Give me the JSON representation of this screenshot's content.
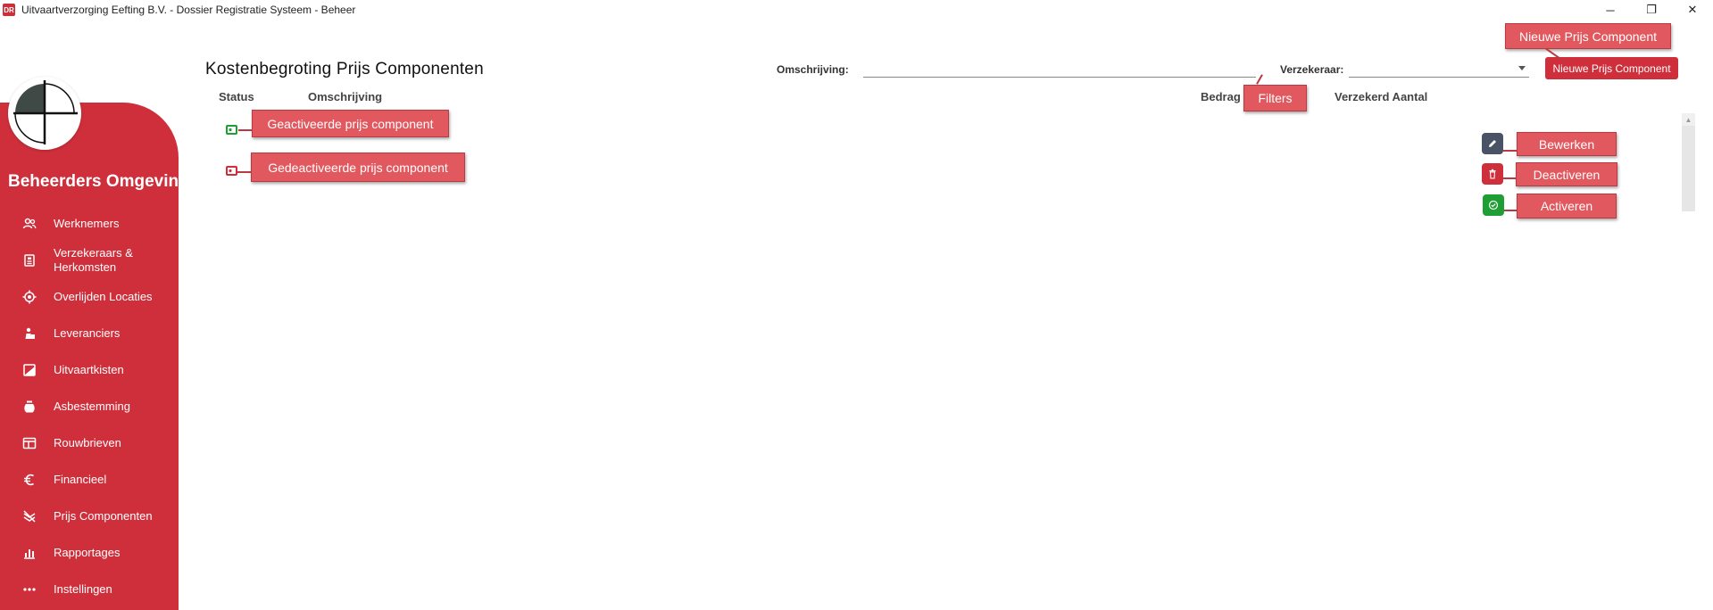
{
  "window": {
    "title": "Uitvaartverzorging Eefting B.V. - Dossier Registratie Systeem - Beheer",
    "app_icon": "DR",
    "controls": {
      "minimize": "─",
      "restore": "❐",
      "close": "✕"
    }
  },
  "sidebar": {
    "title": "Beheerders Omgeving",
    "items": [
      {
        "label": "Werknemers",
        "icon": "people-icon"
      },
      {
        "label": "Verzekeraars &\nHerkomsten",
        "icon": "id-card-icon"
      },
      {
        "label": "Overlijden Locaties",
        "icon": "location-icon"
      },
      {
        "label": "Leveranciers",
        "icon": "supplier-icon"
      },
      {
        "label": "Uitvaartkisten",
        "icon": "coffin-icon"
      },
      {
        "label": "Asbestemming",
        "icon": "urn-icon"
      },
      {
        "label": "Rouwbrieven",
        "icon": "letter-icon"
      },
      {
        "label": "Financieel",
        "icon": "euro-icon"
      },
      {
        "label": "Prijs Componenten",
        "icon": "price-component-icon"
      },
      {
        "label": "Rapportages",
        "icon": "report-icon"
      },
      {
        "label": "Instellingen",
        "icon": "more-icon"
      }
    ]
  },
  "main": {
    "title": "Kostenbegroting Prijs Componenten",
    "filters": {
      "omschrijving_label": "Omschrijving:",
      "omschrijving_value": "",
      "verzekeraar_label": "Verzekeraar:",
      "verzekeraar_value": ""
    },
    "new_button_label": "Nieuwe Prijs Component",
    "columns": {
      "status": "Status",
      "omschrijving": "Omschrijving",
      "bedrag": "Bedrag",
      "verzekerd_aantal": "Verzekerd Aantal"
    },
    "callouts": {
      "new_component": "Nieuwe Prijs Component",
      "filters": "Filters",
      "activated": "Geactiveerde prijs component",
      "deactivated": "Gedeactiveerde prijs component",
      "edit": "Bewerken",
      "deactivate": "Deactiveren",
      "activate": "Activeren"
    },
    "colors": {
      "brand_red": "#cf2f3b",
      "active_green": "#1e9e33",
      "edit_slate": "#4a5366",
      "callout_fill": "#e2585f"
    }
  }
}
